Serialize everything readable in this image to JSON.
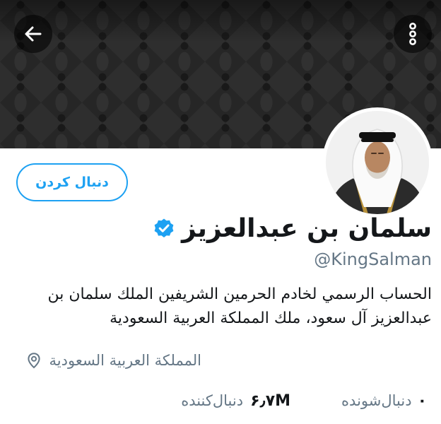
{
  "header": {
    "back_icon": "arrow-left-icon",
    "more_icon": "more-vertical-icon"
  },
  "profile": {
    "display_name": "سلمان بن عبدالعزيز",
    "verified": true,
    "handle": "@KingSalman",
    "bio": "الحساب الرسمي لخادم الحرمين الشريفين الملك سلمان بن عبدالعزيز آل سعود، ملك المملكة العربية السعودية",
    "location": "المملكة العربية السعودية",
    "follow_button_label": "دنبال کردن"
  },
  "stats": {
    "following_value": "۰",
    "following_label": "دنبال‌شونده",
    "followers_value": "۶٫۷M",
    "followers_label": "دنبال‌کننده"
  },
  "colors": {
    "accent": "#1da1f2",
    "secondary_text": "#657786",
    "primary_text": "#14171a",
    "banner": "#262626"
  }
}
